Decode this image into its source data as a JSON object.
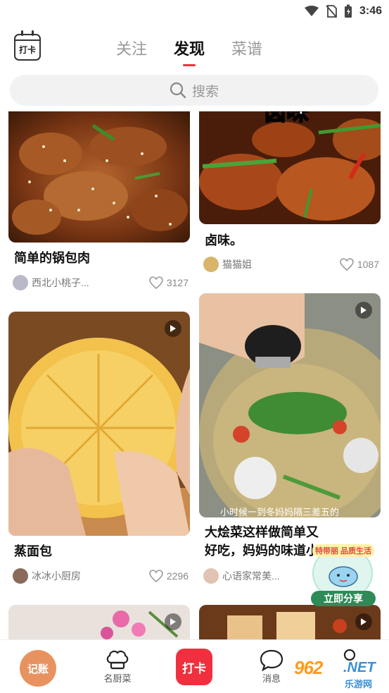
{
  "status_bar": {
    "time": "3:46"
  },
  "header": {
    "checkin_icon_label": "打卡",
    "tabs": [
      {
        "label": "关注",
        "active": false
      },
      {
        "label": "发现",
        "active": true
      },
      {
        "label": "菜谱",
        "active": false
      }
    ]
  },
  "search": {
    "placeholder": "搜索"
  },
  "feed": {
    "cards": [
      {
        "title": "简单的锅包肉",
        "author": "西北小桃子...",
        "likes": "3127",
        "video": false
      },
      {
        "title": "卤味。",
        "author": "猫猫姐",
        "likes": "1087",
        "video": false,
        "overlay_text": "卤味"
      },
      {
        "title": "蒸面包",
        "author": "冰冰小厨房",
        "likes": "2296",
        "video": true
      },
      {
        "title": "大烩菜这样做简单又好吃，妈妈的味道小时候的",
        "author": "心语家常美...",
        "likes": "",
        "video": true,
        "overlay_text": "小时候一到冬妈妈隔三差五的"
      },
      {
        "title": "",
        "author": "",
        "likes": "",
        "video": true
      },
      {
        "title": "",
        "author": "",
        "likes": "",
        "video": true
      }
    ]
  },
  "share_badge": {
    "top_text": "特带丽 品质生活",
    "button_label": "立即分享"
  },
  "bottom_nav": {
    "items": [
      {
        "label": "记账",
        "icon": "account-book-icon"
      },
      {
        "label": "名厨菜",
        "icon": "chef-hat-icon"
      },
      {
        "label": "打卡",
        "icon": "checkin-button"
      },
      {
        "label": "消息",
        "icon": "chat-bubble-icon"
      },
      {
        "label": "",
        "icon": "profile-icon"
      }
    ]
  },
  "watermark": {
    "number": "962",
    "suffix": ".NET",
    "subtitle": "乐游网"
  },
  "colors": {
    "accent": "#f0303e",
    "jizhang": "#e8935f",
    "share_green": "#2e8b57"
  }
}
